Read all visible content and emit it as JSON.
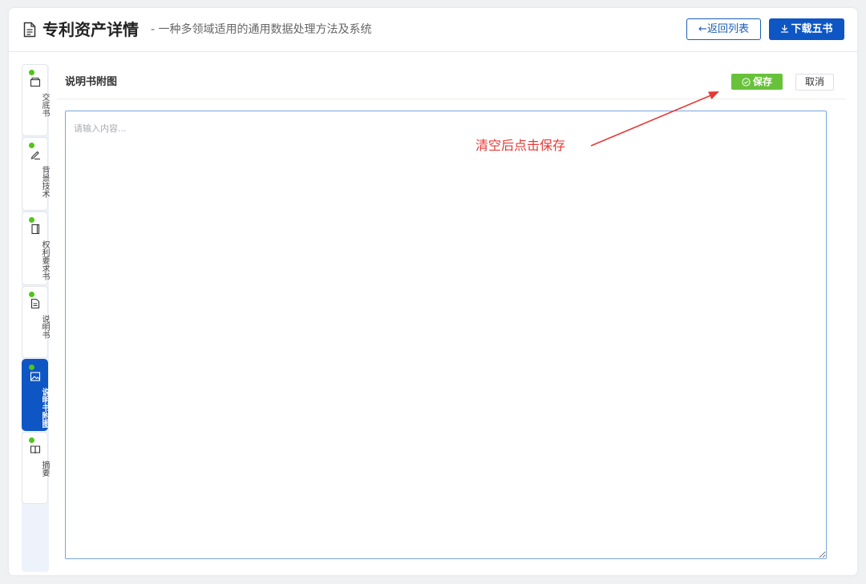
{
  "header": {
    "title": "专利资产详情",
    "subtitle": "- 一种多领域适用的通用数据处理方法及系统",
    "back_label": "←返回列表",
    "download_label": "下载五书",
    "icon": "document-icon"
  },
  "sidebar": {
    "tabs": [
      {
        "label": "交底书",
        "icon": "folder-icon",
        "status": "complete",
        "active": false
      },
      {
        "label": "背景技术",
        "icon": "edit-icon",
        "status": "complete",
        "active": false
      },
      {
        "label": "权利要求书",
        "icon": "book-icon",
        "status": "complete",
        "active": false
      },
      {
        "label": "说明书",
        "icon": "document-icon",
        "status": "complete",
        "active": false
      },
      {
        "label": "说明书附图",
        "icon": "image-icon",
        "status": "complete",
        "active": true
      },
      {
        "label": "摘要",
        "icon": "open-book-icon",
        "status": "complete",
        "active": false
      }
    ]
  },
  "section": {
    "title": "说明书附图",
    "save_label": "保存",
    "cancel_label": "取消"
  },
  "editor": {
    "value": "",
    "placeholder": "请输入内容..."
  },
  "annotation": {
    "text": "清空后点击保存"
  },
  "colors": {
    "primary": "#0d56c4",
    "save_green": "#67c23a",
    "status_dot": "#52c41a",
    "annotation_red": "#e53935"
  }
}
